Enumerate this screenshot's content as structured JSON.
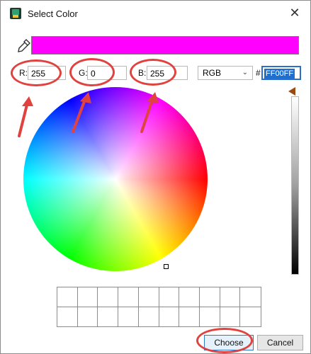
{
  "window": {
    "title": "Select Color",
    "close_glyph": "✕"
  },
  "preview": {
    "color": "#FF00FF"
  },
  "fields": {
    "r": {
      "label": "R:",
      "value": "255"
    },
    "g": {
      "label": "G:",
      "value": "0"
    },
    "b": {
      "label": "B:",
      "value": "255"
    }
  },
  "color_model": {
    "selected": "RGB"
  },
  "hex": {
    "prefix": "#",
    "value": "FF00FF"
  },
  "buttons": {
    "choose": "Choose",
    "cancel": "Cancel"
  },
  "icons": {
    "eyedropper": "eyedropper-icon",
    "app": "app-icon",
    "close": "close-icon"
  },
  "annotation_color": "#e0433f"
}
